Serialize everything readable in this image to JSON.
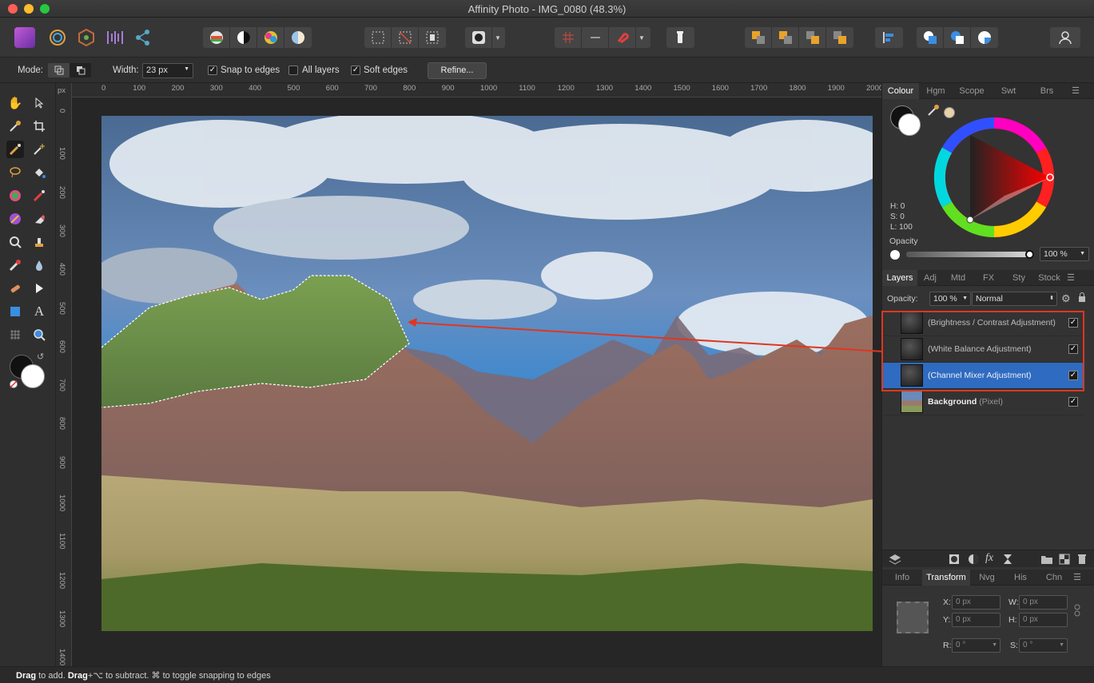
{
  "window": {
    "title": "Affinity Photo - IMG_0080 (48.3%)"
  },
  "context_toolbar": {
    "mode_label": "Mode:",
    "width_label": "Width:",
    "width_value": "23 px",
    "snap_label": "Snap to edges",
    "all_layers_label": "All layers",
    "soft_edges_label": "Soft edges",
    "refine_label": "Refine...",
    "snap_checked": true,
    "all_layers_checked": false,
    "soft_edges_checked": true
  },
  "rulers": {
    "unit": "px",
    "horizontal": [
      "0",
      "100",
      "200",
      "300",
      "400",
      "500",
      "600",
      "700",
      "800",
      "900",
      "1000",
      "1100",
      "1200",
      "1300",
      "1400",
      "1500",
      "1600",
      "1700",
      "1800",
      "1900",
      "2000"
    ],
    "vertical": [
      "0",
      "100",
      "200",
      "300",
      "400",
      "500",
      "600",
      "700",
      "800",
      "900",
      "1000",
      "1100",
      "1200",
      "1300",
      "1400"
    ]
  },
  "colour_panel": {
    "tabs": [
      "Colour",
      "Hgm",
      "Scope",
      "Swt",
      "Brs"
    ],
    "active_tab": "Colour",
    "h": "H: 0",
    "s": "S: 0",
    "l": "L: 100",
    "opacity_label": "Opacity",
    "opacity_value": "100 %"
  },
  "layers_panel": {
    "tabs": [
      "Layers",
      "Adj",
      "Mtd",
      "FX",
      "Sty",
      "Stock"
    ],
    "active_tab": "Layers",
    "opacity_label": "Opacity:",
    "opacity_value": "100 %",
    "blend_mode": "Normal",
    "layers": [
      {
        "name": "(Brightness / Contrast Adjustment)",
        "visible": true,
        "selected": false
      },
      {
        "name": "(White Balance Adjustment)",
        "visible": true,
        "selected": false
      },
      {
        "name": "(Channel Mixer Adjustment)",
        "visible": true,
        "selected": true
      },
      {
        "name": "Background",
        "suffix": "(Pixel)",
        "visible": true,
        "selected": false
      }
    ]
  },
  "transform_panel": {
    "tabs": [
      "Info",
      "Transform",
      "Nvg",
      "His",
      "Chn"
    ],
    "active_tab": "Transform",
    "x_label": "X:",
    "x_value": "0 px",
    "y_label": "Y:",
    "y_value": "0 px",
    "w_label": "W:",
    "w_value": "0 px",
    "h_label": "H:",
    "h_value": "0 px",
    "r_label": "R:",
    "r_value": "0 °",
    "s_label": "S:",
    "s_value": "0 °"
  },
  "status_bar": {
    "drag1": "Drag",
    "text1": " to add. ",
    "drag2": "Drag",
    "text2": "+⌥ to subtract. ⌘ to toggle snapping to edges"
  },
  "colors": {
    "accent": "#2f6bc0",
    "annotation": "#e0361f"
  }
}
